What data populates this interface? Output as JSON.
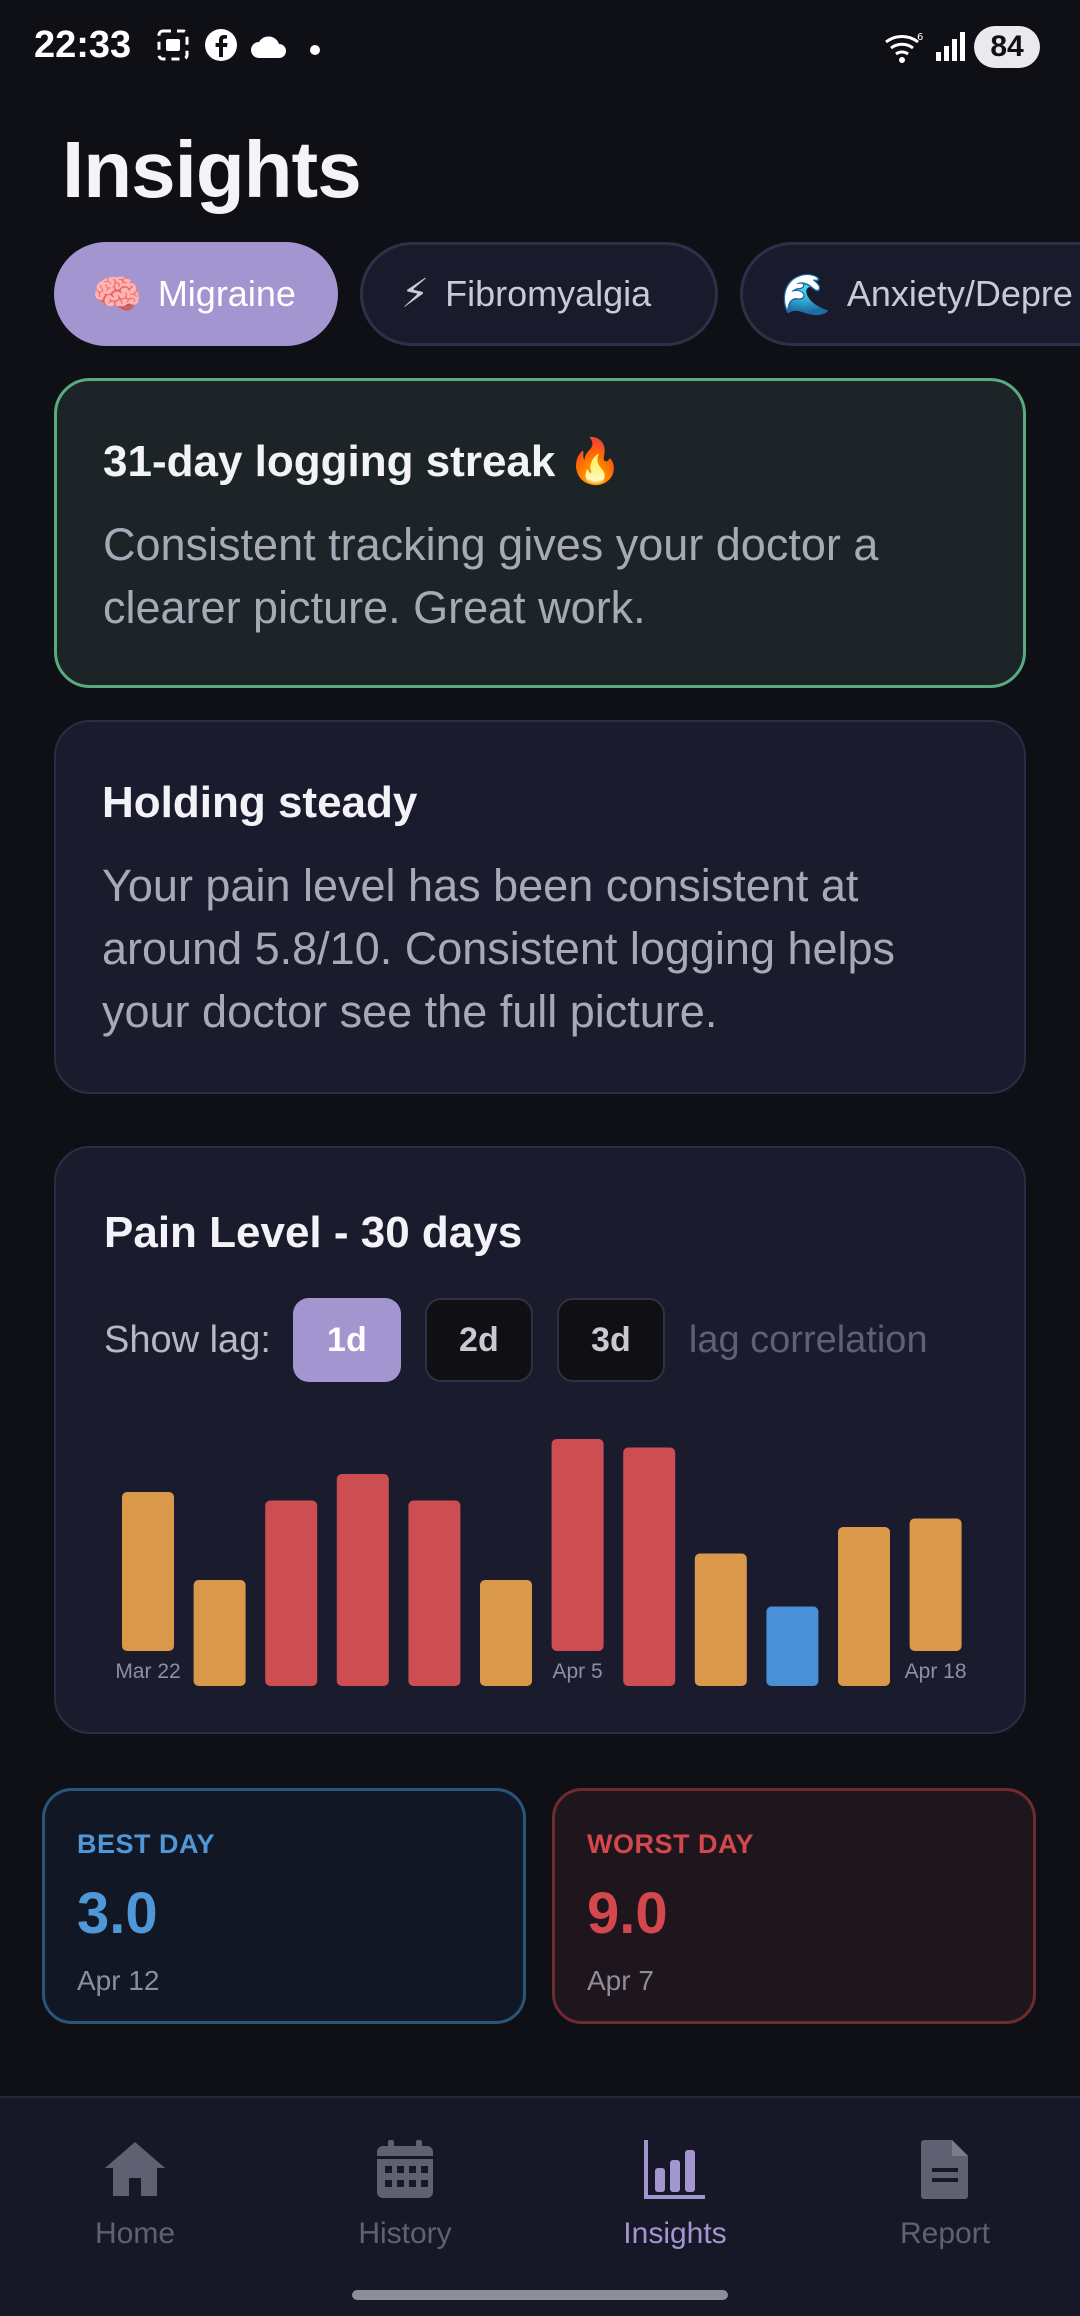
{
  "status_bar": {
    "time": "22:33",
    "battery": "84"
  },
  "page": {
    "title": "Insights"
  },
  "conditions": [
    {
      "emoji": "🧠",
      "label": "Migraine",
      "selected": true
    },
    {
      "emoji": "⚡",
      "label": "Fibromyalgia",
      "selected": false
    },
    {
      "emoji": "🌊",
      "label": "Anxiety/Depre",
      "selected": false
    }
  ],
  "streak_card": {
    "title": "31-day logging streak 🔥",
    "body": "Consistent tracking gives your doctor a clearer picture. Great work."
  },
  "steady_card": {
    "title": "Holding steady",
    "body": "Your pain level has been consistent at around 5.8/10. Consistent logging helps your doctor see the full picture."
  },
  "pain_chart": {
    "title": "Pain Level - 30 days",
    "lag_label": "Show lag:",
    "lag_options": [
      "1d",
      "2d",
      "3d"
    ],
    "lag_selected": "1d",
    "lag_note": "lag correlation"
  },
  "chart_data": {
    "type": "bar",
    "title": "Pain Level - 30 days",
    "x_tick_labels": [
      "Mar 22",
      "Apr 5",
      "Apr 18"
    ],
    "values": [
      6,
      4,
      7,
      8,
      7,
      4,
      8,
      9,
      5,
      3,
      6,
      5
    ],
    "offset_upward": [
      1,
      0,
      0,
      0,
      0,
      0,
      1,
      0,
      0,
      0,
      0,
      1
    ],
    "colors": [
      "#d9984a",
      "#d9984a",
      "#cc4e52",
      "#cc4e52",
      "#cc4e52",
      "#d9984a",
      "#cc4e52",
      "#cc4e52",
      "#d9984a",
      "#4a90d6",
      "#d9984a",
      "#d9984a"
    ],
    "ylim": [
      0,
      10
    ]
  },
  "stats": {
    "best": {
      "label": "BEST DAY",
      "value": "3.0",
      "date": "Apr 12"
    },
    "worst": {
      "label": "WORST DAY",
      "value": "9.0",
      "date": "Apr 7"
    }
  },
  "nav": [
    {
      "label": "Home",
      "icon": "home-icon",
      "active": false
    },
    {
      "label": "History",
      "icon": "calendar-icon",
      "active": false
    },
    {
      "label": "Insights",
      "icon": "bar-chart-icon",
      "active": true
    },
    {
      "label": "Report",
      "icon": "document-icon",
      "active": false
    }
  ]
}
